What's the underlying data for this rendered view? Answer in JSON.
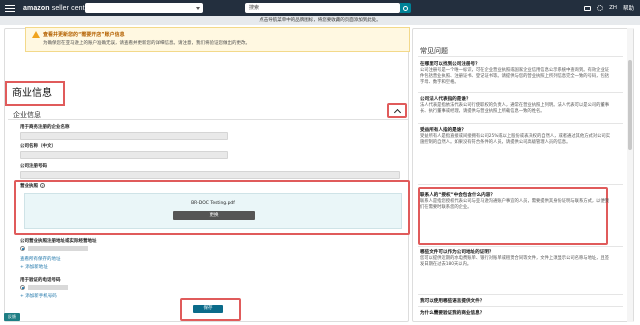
{
  "topbar": {
    "logo": "amazon",
    "logo_sub": " seller central",
    "search_placeholder": "搜索",
    "lang": "ZH",
    "help": "帮助"
  },
  "notice": "点击导航菜单中的品牌图标，将您要收藏的页面添加到此处。",
  "alert": {
    "title": "查看并更新您的“需要开店”账户信息",
    "body": "为确保您在亚马逊上的账户准确无误，请查看并更新您的详细信息。请注意，我们将验证您做出的更改。"
  },
  "business_info_title": "商业信息",
  "section_title": "企业信息",
  "fields": {
    "company_name_label": "用于商务注册的企业名称",
    "chinese_name_label": "公司名称（中文）",
    "reg_number_label": "公司注册号码"
  },
  "upload": {
    "label": "营业执照",
    "file_name": "BR-DOC Testing.pdf",
    "replace_label": "更换"
  },
  "address": {
    "label": "公司营业执照注册地址或实际经营地址",
    "view_all_link": "查看所有保存的地址",
    "add_link": "+ 添加新地址"
  },
  "phone": {
    "label": "用于验证的电话号码",
    "add_link": "+ 添加新手机号码"
  },
  "save_label": "保存",
  "feedback_label": "反馈",
  "faq": {
    "title": "常见问题",
    "items": [
      {
        "q": "在哪里可以找到公司注册号？",
        "a": "公司注册号是一个唯一标识，可在企业营业执照或国家企业信用信息公示系统中查询到。有效企业证件包括营业执照、注册证书、登记证书等。请提供与您的营业执照上所列信息完全一致的号码，包括字母、数字和空格。"
      },
      {
        "q": "公司法人代表指的是谁？",
        "a": "法人代表是指依法代表公司行使职权的负责人，通常在营业执照上列明。法人代表可以是公司的董事长、执行董事或经理，请提供与营业执照上所载信息一致的姓名。"
      },
      {
        "q": "受益所有人指的是谁？",
        "a": "受益所有人是指直接或间接拥有公司25%或以上股份或表决权的自然人，或者通过其他方式对公司实施控制的自然人。如果没有符合条件的人员，请提供公司高级管理人员的信息。"
      },
      {
        "q": "联系人的“授权”中会包含什么内容？",
        "a": "联系人是指您授权代表公司与亚马逊沟通账户事宜的人员，需要提供其身份证明与联系方式，以便我们在需要时联系您的企业。"
      },
      {
        "q": "哪些文件可以作为公司地址的证明？",
        "a": "您可以提供近期的水电费账单、银行对账单或租赁合同等文件，文件上须显示公司名称与地址，且签发日期在过去180天以内。"
      },
      {
        "q": "我可以使用哪些语言提供文件？",
        "a": ""
      },
      {
        "q": "为什么需要验证我的商业信息？",
        "a": ""
      }
    ]
  }
}
